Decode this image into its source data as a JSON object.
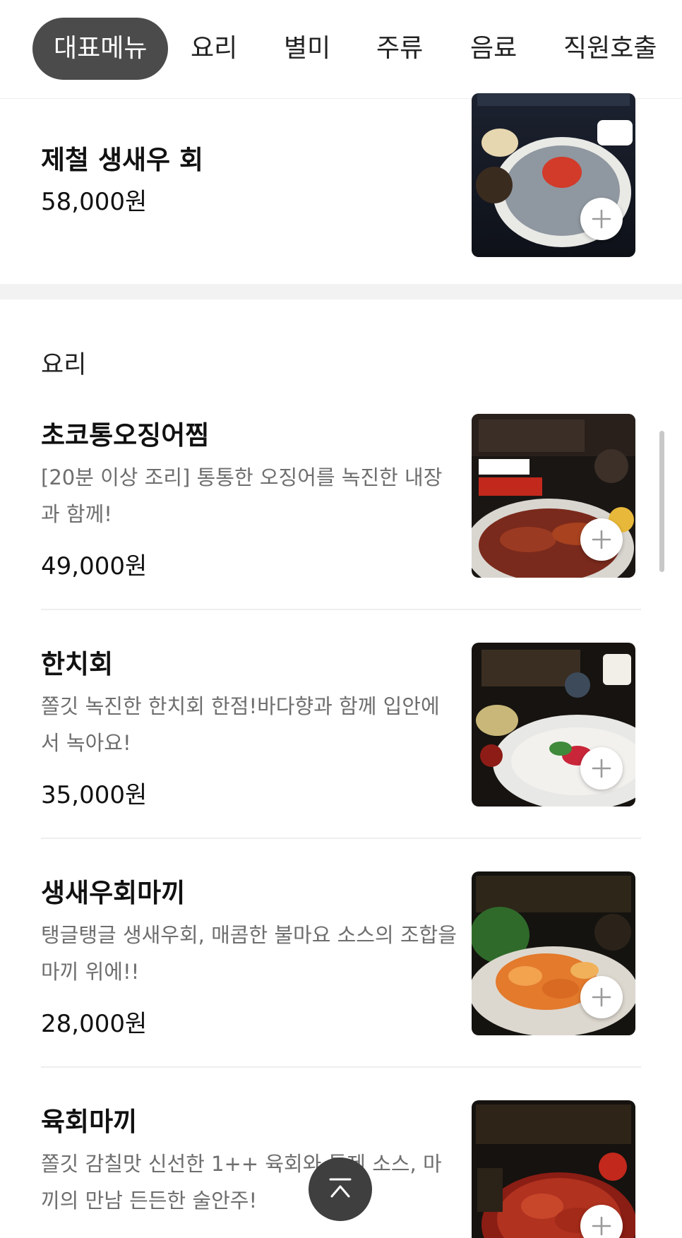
{
  "tabs": [
    "대표메뉴",
    "요리",
    "별미",
    "주류",
    "음료",
    "직원호출"
  ],
  "active_tab_index": 0,
  "featured": {
    "name": "제철 생새우 회",
    "price": "58,000원"
  },
  "section": {
    "title": "요리"
  },
  "items": [
    {
      "name": "초코통오징어찜",
      "desc": "[20분 이상 조리] 통통한 오징어를 녹진한 내장과 함께!",
      "price": "49,000원"
    },
    {
      "name": "한치회",
      "desc": "쫄깃 녹진한 한치회 한점!바다향과 함께 입안에서 녹아요!",
      "price": "35,000원"
    },
    {
      "name": "생새우회마끼",
      "desc": "탱글탱글 생새우회, 매콤한 불마요 소스의 조합을 마끼 위에!!",
      "price": "28,000원"
    },
    {
      "name": "육회마끼",
      "desc": "쫄깃 감칠맛 신선한 1++ 육회와 특제 소스, 마끼의 만남 든든한 술안주!",
      "price": ""
    }
  ],
  "icons": {
    "add": "plus-icon",
    "scroll_top": "chevron-up-icon"
  },
  "colors": {
    "active_tab_bg": "#4b4b4b",
    "desc_text": "#6e6e6e",
    "top_button_bg": "#3f3f3f"
  }
}
